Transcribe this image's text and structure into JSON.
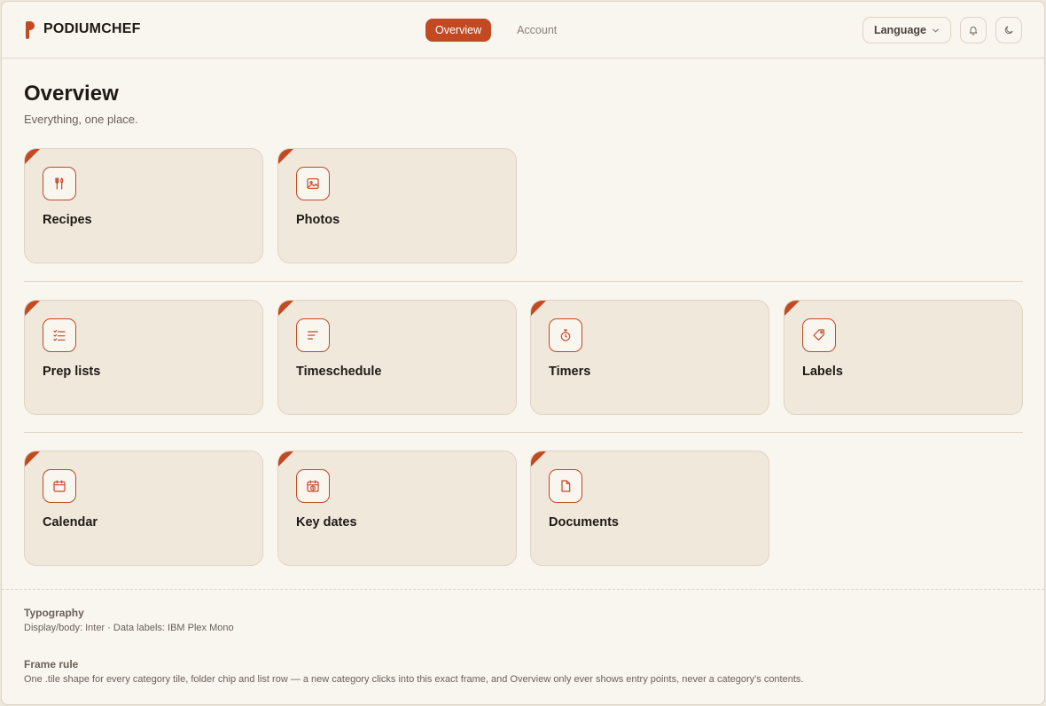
{
  "app": {
    "brand_name": "PODIUMCHEF",
    "accent_color": "#c24a22"
  },
  "header": {
    "tabs": [
      {
        "label": "Overview",
        "active": true
      },
      {
        "label": "Account",
        "active": false
      }
    ],
    "language_label": "Language",
    "icons": [
      "chevron-down-icon",
      "bell-icon",
      "moon-icon"
    ]
  },
  "page": {
    "title": "Overview",
    "subtitle": "Everything, one place."
  },
  "tiles": [
    {
      "label": "Recipes",
      "icon": "utensils-icon"
    },
    {
      "label": "Photos",
      "icon": "image-icon"
    },
    {
      "label": "Prep lists",
      "icon": "checklist-icon"
    },
    {
      "label": "Timeschedule",
      "icon": "lines-icon"
    },
    {
      "label": "Timers",
      "icon": "stopwatch-icon"
    },
    {
      "label": "Labels",
      "icon": "tag-icon"
    },
    {
      "label": "Calendar",
      "icon": "calendar-icon"
    },
    {
      "label": "Key dates",
      "icon": "calendar-clock-icon"
    },
    {
      "label": "Documents",
      "icon": "document-icon"
    }
  ],
  "notes": [
    {
      "title": "Typography",
      "body": "Display/body: Inter · Data labels: IBM Plex Mono"
    },
    {
      "title": "Frame rule",
      "body": "One .tile shape for every category tile, folder chip and list row — a new category clicks into this exact frame, and Overview only ever shows entry points, never a category's contents."
    }
  ]
}
